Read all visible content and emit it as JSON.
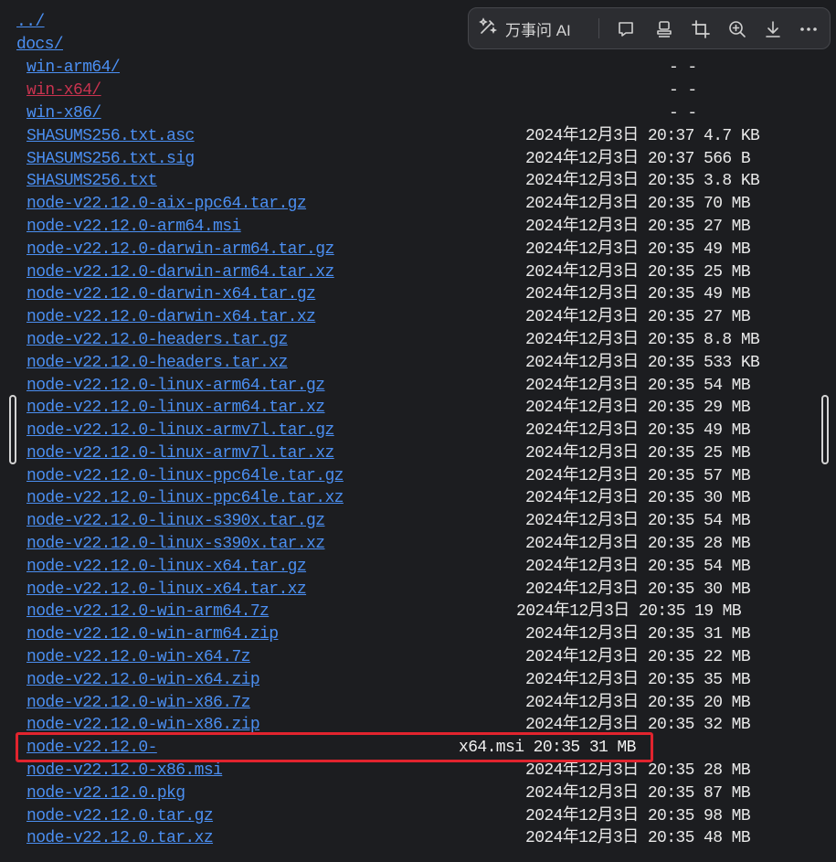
{
  "parent_link": "../",
  "docs_link": "docs/",
  "directories": [
    {
      "name": "win-arm64/",
      "info": "- -"
    },
    {
      "name": "win-x64/",
      "info": "- -"
    },
    {
      "name": "win-x86/",
      "info": "- -"
    }
  ],
  "files": [
    {
      "name": "SHASUMS256.txt.asc",
      "info": "2024年12月3日 20:37 4.7 KB"
    },
    {
      "name": "SHASUMS256.txt.sig",
      "info": "2024年12月3日 20:37 566 B"
    },
    {
      "name": "SHASUMS256.txt",
      "info": "2024年12月3日 20:35 3.8 KB"
    },
    {
      "name": "node-v22.12.0-aix-ppc64.tar.gz",
      "info": "2024年12月3日 20:35 70 MB"
    },
    {
      "name": "node-v22.12.0-arm64.msi",
      "info": "2024年12月3日 20:35 27 MB"
    },
    {
      "name": "node-v22.12.0-darwin-arm64.tar.gz",
      "info": "2024年12月3日 20:35 49 MB"
    },
    {
      "name": "node-v22.12.0-darwin-arm64.tar.xz",
      "info": "2024年12月3日 20:35 25 MB"
    },
    {
      "name": "node-v22.12.0-darwin-x64.tar.gz",
      "info": "2024年12月3日 20:35 49 MB"
    },
    {
      "name": "node-v22.12.0-darwin-x64.tar.xz",
      "info": "2024年12月3日 20:35 27 MB"
    },
    {
      "name": "node-v22.12.0-headers.tar.gz",
      "info": "2024年12月3日 20:35 8.8 MB"
    },
    {
      "name": "node-v22.12.0-headers.tar.xz",
      "info": "2024年12月3日 20:35 533 KB"
    },
    {
      "name": "node-v22.12.0-linux-arm64.tar.gz",
      "info": "2024年12月3日 20:35 54 MB"
    },
    {
      "name": "node-v22.12.0-linux-arm64.tar.xz",
      "info": "2024年12月3日 20:35 29 MB"
    },
    {
      "name": "node-v22.12.0-linux-armv7l.tar.gz",
      "info": "2024年12月3日 20:35 49 MB"
    },
    {
      "name": "node-v22.12.0-linux-armv7l.tar.xz",
      "info": "2024年12月3日 20:35 25 MB"
    },
    {
      "name": "node-v22.12.0-linux-ppc64le.tar.gz",
      "info": "2024年12月3日 20:35 57 MB"
    },
    {
      "name": "node-v22.12.0-linux-ppc64le.tar.xz",
      "info": "2024年12月3日 20:35 30 MB"
    },
    {
      "name": "node-v22.12.0-linux-s390x.tar.gz",
      "info": "2024年12月3日 20:35 54 MB"
    },
    {
      "name": "node-v22.12.0-linux-s390x.tar.xz",
      "info": "2024年12月3日 20:35 28 MB"
    },
    {
      "name": "node-v22.12.0-linux-x64.tar.gz",
      "info": "2024年12月3日 20:35 54 MB"
    },
    {
      "name": "node-v22.12.0-linux-x64.tar.xz",
      "info": "2024年12月3日 20:35 30 MB"
    },
    {
      "name": "node-v22.12.0-win-arm64.7z",
      "info": "2024年12月3日 20:35 19 MB"
    },
    {
      "name": "node-v22.12.0-win-arm64.zip",
      "info": "2024年12月3日 20:35 31 MB"
    },
    {
      "name": "node-v22.12.0-win-x64.7z",
      "info": "2024年12月3日 20:35 22 MB"
    },
    {
      "name": "node-v22.12.0-win-x64.zip",
      "info": "2024年12月3日 20:35 35 MB"
    },
    {
      "name": "node-v22.12.0-win-x86.7z",
      "info": "2024年12月3日 20:35 20 MB"
    },
    {
      "name": "node-v22.12.0-win-x86.zip",
      "info": "2024年12月3日 20:35 32 MB"
    },
    {
      "name": "node-v22.12.0-",
      "info": ""
    },
    {
      "name": "node-v22.12.0-x86.msi",
      "info": "2024年12月3日 20:35 28 MB"
    },
    {
      "name": "node-v22.12.0.pkg",
      "info": "2024年12月3日 20:35 87 MB"
    },
    {
      "name": "node-v22.12.0.tar.gz",
      "info": "2024年12月3日 20:35 98 MB"
    },
    {
      "name": "node-v22.12.0.tar.xz",
      "info": "2024年12月3日 20:35 48 MB"
    }
  ],
  "highlighted": {
    "name": "node-v22.12.0-",
    "info": "x64.msi 20:35 31 MB"
  },
  "toolbar": {
    "ai_label": "万事问 AI",
    "icons": [
      "ai-sparkle-icon",
      "comment-icon",
      "stamp-icon",
      "crop-icon",
      "zoom-in-icon",
      "download-icon",
      "more-icon"
    ]
  },
  "colors": {
    "link": "#4b8ff2",
    "visited_link": "#c8334f",
    "background": "#1c1d20",
    "highlight": "#e1242e"
  }
}
